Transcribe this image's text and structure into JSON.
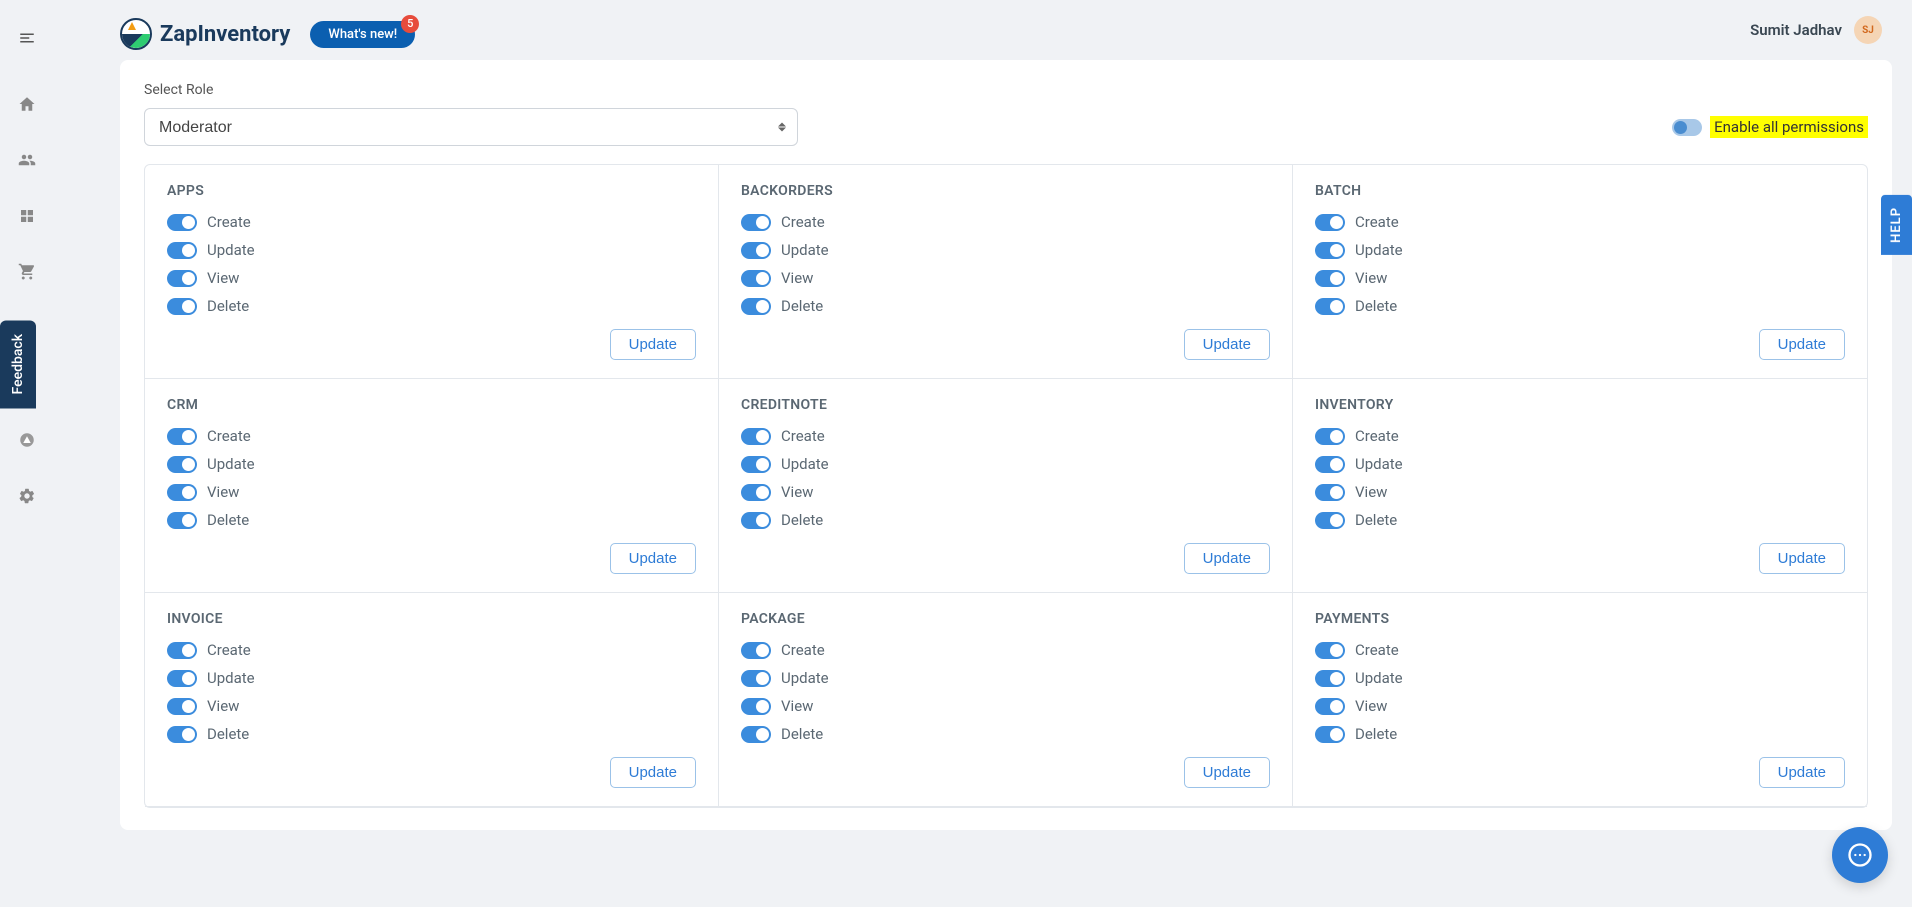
{
  "header": {
    "logo_text": "ZapInventory",
    "whats_new_label": "What's new!",
    "whats_new_count": "5",
    "username": "Sumit Jadhav",
    "avatar_initials": "SJ"
  },
  "sidebar": {
    "feedback_label": "Feedback",
    "help_label": "HELP"
  },
  "content": {
    "select_role_label": "Select Role",
    "selected_role": "Moderator",
    "enable_all_label": "Enable all permissions",
    "update_button_label": "Update",
    "permissions": {
      "create": "Create",
      "update": "Update",
      "view": "View",
      "delete": "Delete"
    },
    "cards": [
      {
        "title": "APPS"
      },
      {
        "title": "BACKORDERS"
      },
      {
        "title": "BATCH"
      },
      {
        "title": "CRM"
      },
      {
        "title": "CREDITNOTE"
      },
      {
        "title": "INVENTORY"
      },
      {
        "title": "INVOICE"
      },
      {
        "title": "PACKAGE"
      },
      {
        "title": "PAYMENTS"
      }
    ]
  }
}
